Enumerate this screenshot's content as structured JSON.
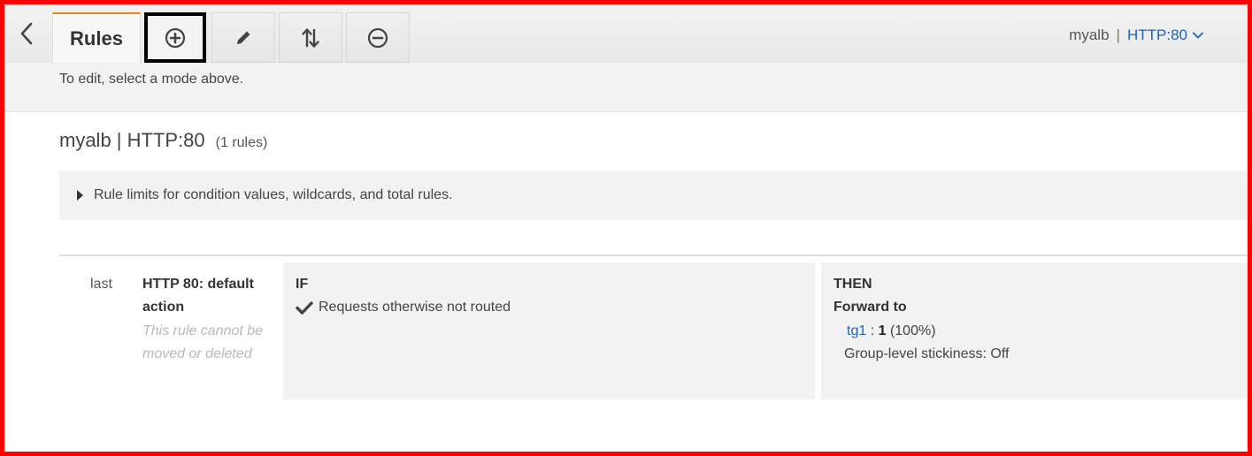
{
  "toolbar": {
    "tab_label": "Rules",
    "icons": {
      "back": "chevron-left-icon",
      "add": "plus-circle-icon",
      "edit": "pencil-icon",
      "reorder": "sort-arrows-icon",
      "delete": "minus-circle-icon",
      "listener_dropdown": "chevron-down-icon"
    },
    "selected_tool": "add",
    "listener": {
      "lb_name": "myalb",
      "separator": "|",
      "listener_label": "HTTP:80"
    }
  },
  "hint": "To edit, select a mode above.",
  "main": {
    "title": "myalb | HTTP:80",
    "rule_count": "(1 rules)",
    "limits_expander": "Rule limits for condition values, wildcards, and total rules."
  },
  "rule": {
    "priority": "last",
    "name": "HTTP 80: default action",
    "note": "This rule cannot be moved or deleted",
    "if_label": "IF",
    "condition": "Requests otherwise not routed",
    "then_label": "THEN",
    "action": "Forward to",
    "target_group": "tg1",
    "target_sep": " : ",
    "target_weight": "1",
    "target_percent": " (100%)",
    "stickiness": "Group-level stickiness: Off"
  },
  "colors": {
    "accent_tab": "#e88b1a",
    "link": "#1f62b8",
    "frame": "#ff0000"
  }
}
